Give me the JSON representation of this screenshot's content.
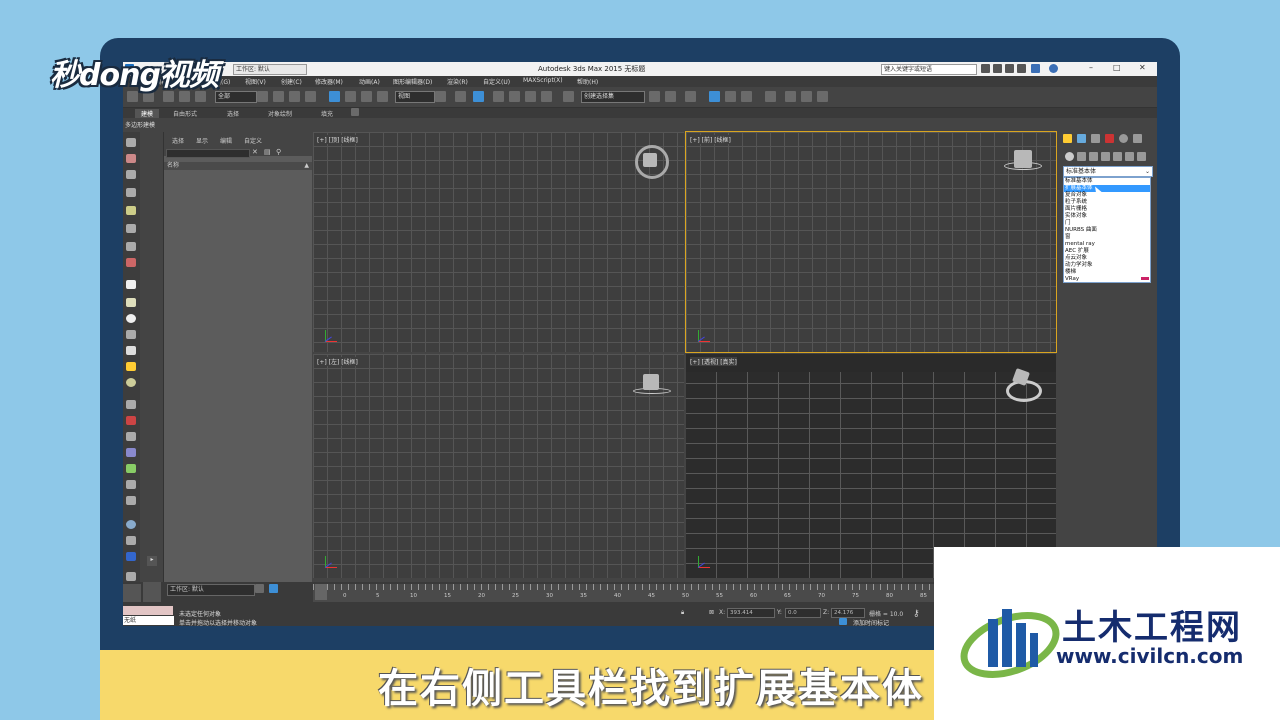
{
  "app": {
    "title": "Autodesk 3ds Max  2015     无标题",
    "workspace_label": "工作区: 默认",
    "search_placeholder": "键入关键字或短语"
  },
  "menu": [
    "编辑(E)",
    "工具(T)",
    "组(G)",
    "视图(V)",
    "创建(C)",
    "修改器(M)",
    "动画(A)",
    "图形编辑器(D)",
    "渲染(R)",
    "自定义(U)",
    "MAXScript(X)",
    "帮助(H)"
  ],
  "toolbar": {
    "filter_select": "全部",
    "view_select": "视图",
    "named_selection": "创建选择集"
  },
  "ribbon": {
    "tabs": [
      "建模",
      "自由形式",
      "选择",
      "对象绘制",
      "填充"
    ],
    "subtab": "多边形建模"
  },
  "scene_explorer": {
    "tabs": [
      "选择",
      "显示",
      "编辑",
      "自定义"
    ],
    "column": "名称"
  },
  "viewports": {
    "top_label": "[+] [顶] [线框]",
    "front_label": "[+] [前] [线框]",
    "left_label": "[+] [左] [线框]",
    "persp_label": "[+] [透视] [真实]"
  },
  "command_panel": {
    "dropdown_value": "标准基本体",
    "options": [
      "标准基本体",
      "扩展基本体",
      "复合对象",
      "粒子系统",
      "面片栅格",
      "实体对象",
      "门",
      "NURBS 曲面",
      "窗",
      "mental ray",
      "AEC 扩展",
      "点云对象",
      "动力学对象",
      "楼梯",
      "VRay"
    ],
    "selected_index": 1
  },
  "bottom": {
    "workspace": "工作区: 默认",
    "timeline_ticks": [
      "0",
      "5",
      "10",
      "15",
      "20",
      "25",
      "30",
      "35",
      "40",
      "45",
      "50",
      "55",
      "60",
      "65",
      "70",
      "75",
      "80",
      "85"
    ],
    "frame_slider": "0 / 100",
    "status_1": "未选定任何对象",
    "status_2": "单击并拖动以选择并移动对象",
    "maxscript_mini": "无纸",
    "x_label": "X:",
    "y_label": "Y:",
    "z_label": "Z:",
    "x_value": "393.414",
    "y_value": "0.0",
    "z_value": "24.176",
    "grid": "栅格 = 10.0",
    "add_time_tag": "添加时间标记"
  },
  "overlay": {
    "watermark": "秒dong视频",
    "subtitle": "在右侧工具栏找到扩展基本体",
    "logo_cn": "土木工程网",
    "logo_url": "www.civilcn.com"
  }
}
